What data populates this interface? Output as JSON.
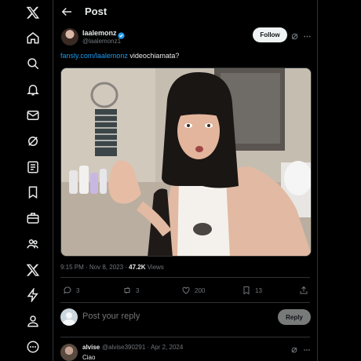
{
  "header": {
    "title": "Post"
  },
  "post": {
    "author_name": "laalemonz",
    "author_handle": "@laalemonz1",
    "follow_label": "Follow",
    "text_link": "fansly.com/laalemonz",
    "text_rest": " videochiamata?",
    "time": "9:15 PM · Nov 8, 2023 · ",
    "views_count": "47.2K",
    "views_label": " Views",
    "replies": "3",
    "reposts": "3",
    "likes": "200",
    "bookmarks": "13"
  },
  "reply_box": {
    "placeholder": "Post your reply",
    "button_label": "Reply"
  },
  "comment": {
    "name": "alvise",
    "handle": "@alvise390291 · Apr 2, 2024",
    "text": "Ciao"
  },
  "colors": {
    "accent": "#1d9bf0",
    "background": "#000000",
    "border": "#2f3336",
    "muted": "#71767b"
  }
}
